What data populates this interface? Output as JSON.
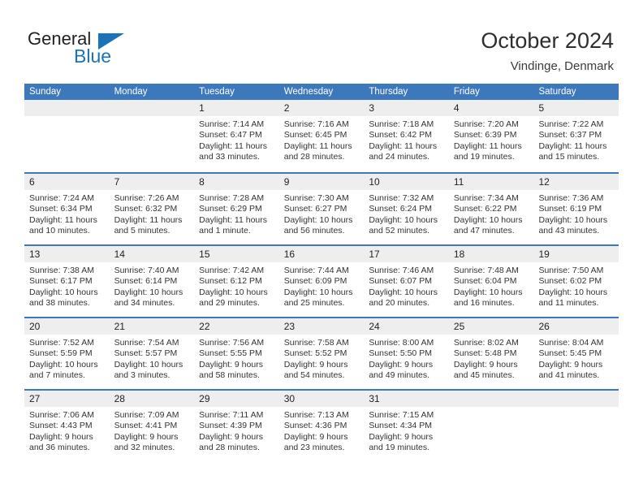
{
  "brand": {
    "name_part1": "General",
    "name_part2": "Blue",
    "accent_color": "#1a72b8"
  },
  "header": {
    "title": "October 2024",
    "subtitle": "Vindinge, Denmark",
    "header_bg_color": "#3d77bc",
    "date_band_color": "#eeeeee"
  },
  "weekdays": [
    "Sunday",
    "Monday",
    "Tuesday",
    "Wednesday",
    "Thursday",
    "Friday",
    "Saturday"
  ],
  "weeks": [
    [
      {
        "day": "",
        "lines": []
      },
      {
        "day": "",
        "lines": []
      },
      {
        "day": "1",
        "lines": [
          "Sunrise: 7:14 AM",
          "Sunset: 6:47 PM",
          "Daylight: 11 hours",
          "and 33 minutes."
        ]
      },
      {
        "day": "2",
        "lines": [
          "Sunrise: 7:16 AM",
          "Sunset: 6:45 PM",
          "Daylight: 11 hours",
          "and 28 minutes."
        ]
      },
      {
        "day": "3",
        "lines": [
          "Sunrise: 7:18 AM",
          "Sunset: 6:42 PM",
          "Daylight: 11 hours",
          "and 24 minutes."
        ]
      },
      {
        "day": "4",
        "lines": [
          "Sunrise: 7:20 AM",
          "Sunset: 6:39 PM",
          "Daylight: 11 hours",
          "and 19 minutes."
        ]
      },
      {
        "day": "5",
        "lines": [
          "Sunrise: 7:22 AM",
          "Sunset: 6:37 PM",
          "Daylight: 11 hours",
          "and 15 minutes."
        ]
      }
    ],
    [
      {
        "day": "6",
        "lines": [
          "Sunrise: 7:24 AM",
          "Sunset: 6:34 PM",
          "Daylight: 11 hours",
          "and 10 minutes."
        ]
      },
      {
        "day": "7",
        "lines": [
          "Sunrise: 7:26 AM",
          "Sunset: 6:32 PM",
          "Daylight: 11 hours",
          "and 5 minutes."
        ]
      },
      {
        "day": "8",
        "lines": [
          "Sunrise: 7:28 AM",
          "Sunset: 6:29 PM",
          "Daylight: 11 hours",
          "and 1 minute."
        ]
      },
      {
        "day": "9",
        "lines": [
          "Sunrise: 7:30 AM",
          "Sunset: 6:27 PM",
          "Daylight: 10 hours",
          "and 56 minutes."
        ]
      },
      {
        "day": "10",
        "lines": [
          "Sunrise: 7:32 AM",
          "Sunset: 6:24 PM",
          "Daylight: 10 hours",
          "and 52 minutes."
        ]
      },
      {
        "day": "11",
        "lines": [
          "Sunrise: 7:34 AM",
          "Sunset: 6:22 PM",
          "Daylight: 10 hours",
          "and 47 minutes."
        ]
      },
      {
        "day": "12",
        "lines": [
          "Sunrise: 7:36 AM",
          "Sunset: 6:19 PM",
          "Daylight: 10 hours",
          "and 43 minutes."
        ]
      }
    ],
    [
      {
        "day": "13",
        "lines": [
          "Sunrise: 7:38 AM",
          "Sunset: 6:17 PM",
          "Daylight: 10 hours",
          "and 38 minutes."
        ]
      },
      {
        "day": "14",
        "lines": [
          "Sunrise: 7:40 AM",
          "Sunset: 6:14 PM",
          "Daylight: 10 hours",
          "and 34 minutes."
        ]
      },
      {
        "day": "15",
        "lines": [
          "Sunrise: 7:42 AM",
          "Sunset: 6:12 PM",
          "Daylight: 10 hours",
          "and 29 minutes."
        ]
      },
      {
        "day": "16",
        "lines": [
          "Sunrise: 7:44 AM",
          "Sunset: 6:09 PM",
          "Daylight: 10 hours",
          "and 25 minutes."
        ]
      },
      {
        "day": "17",
        "lines": [
          "Sunrise: 7:46 AM",
          "Sunset: 6:07 PM",
          "Daylight: 10 hours",
          "and 20 minutes."
        ]
      },
      {
        "day": "18",
        "lines": [
          "Sunrise: 7:48 AM",
          "Sunset: 6:04 PM",
          "Daylight: 10 hours",
          "and 16 minutes."
        ]
      },
      {
        "day": "19",
        "lines": [
          "Sunrise: 7:50 AM",
          "Sunset: 6:02 PM",
          "Daylight: 10 hours",
          "and 11 minutes."
        ]
      }
    ],
    [
      {
        "day": "20",
        "lines": [
          "Sunrise: 7:52 AM",
          "Sunset: 5:59 PM",
          "Daylight: 10 hours",
          "and 7 minutes."
        ]
      },
      {
        "day": "21",
        "lines": [
          "Sunrise: 7:54 AM",
          "Sunset: 5:57 PM",
          "Daylight: 10 hours",
          "and 3 minutes."
        ]
      },
      {
        "day": "22",
        "lines": [
          "Sunrise: 7:56 AM",
          "Sunset: 5:55 PM",
          "Daylight: 9 hours",
          "and 58 minutes."
        ]
      },
      {
        "day": "23",
        "lines": [
          "Sunrise: 7:58 AM",
          "Sunset: 5:52 PM",
          "Daylight: 9 hours",
          "and 54 minutes."
        ]
      },
      {
        "day": "24",
        "lines": [
          "Sunrise: 8:00 AM",
          "Sunset: 5:50 PM",
          "Daylight: 9 hours",
          "and 49 minutes."
        ]
      },
      {
        "day": "25",
        "lines": [
          "Sunrise: 8:02 AM",
          "Sunset: 5:48 PM",
          "Daylight: 9 hours",
          "and 45 minutes."
        ]
      },
      {
        "day": "26",
        "lines": [
          "Sunrise: 8:04 AM",
          "Sunset: 5:45 PM",
          "Daylight: 9 hours",
          "and 41 minutes."
        ]
      }
    ],
    [
      {
        "day": "27",
        "lines": [
          "Sunrise: 7:06 AM",
          "Sunset: 4:43 PM",
          "Daylight: 9 hours",
          "and 36 minutes."
        ]
      },
      {
        "day": "28",
        "lines": [
          "Sunrise: 7:09 AM",
          "Sunset: 4:41 PM",
          "Daylight: 9 hours",
          "and 32 minutes."
        ]
      },
      {
        "day": "29",
        "lines": [
          "Sunrise: 7:11 AM",
          "Sunset: 4:39 PM",
          "Daylight: 9 hours",
          "and 28 minutes."
        ]
      },
      {
        "day": "30",
        "lines": [
          "Sunrise: 7:13 AM",
          "Sunset: 4:36 PM",
          "Daylight: 9 hours",
          "and 23 minutes."
        ]
      },
      {
        "day": "31",
        "lines": [
          "Sunrise: 7:15 AM",
          "Sunset: 4:34 PM",
          "Daylight: 9 hours",
          "and 19 minutes."
        ]
      },
      {
        "day": "",
        "lines": []
      },
      {
        "day": "",
        "lines": []
      }
    ]
  ]
}
